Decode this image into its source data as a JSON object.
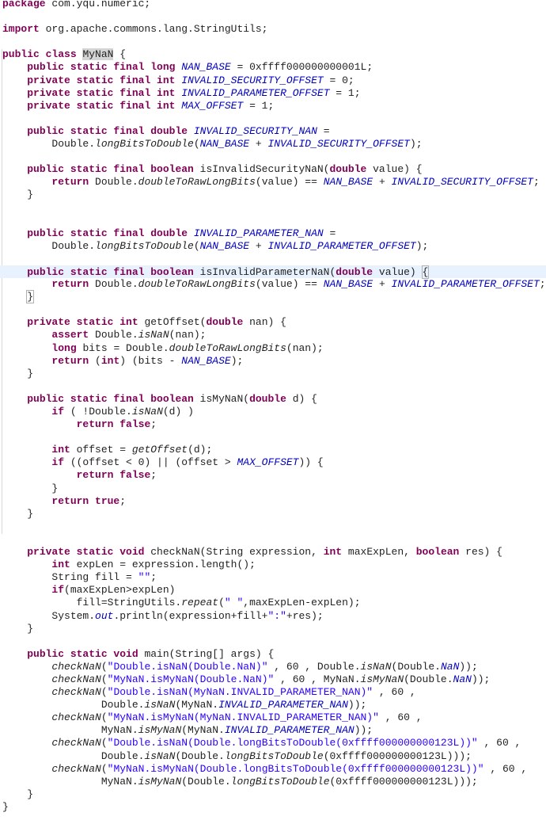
{
  "editor": {
    "current_line": 22,
    "colors": {
      "keyword": "#7f0055",
      "constant": "#0000c0",
      "string": "#2a00ff",
      "current_line_bg": "#e8f2fe"
    },
    "lines": [
      [
        [
          "k",
          "package"
        ],
        [
          "t",
          " com.yqu.numeric;"
        ]
      ],
      [],
      [
        [
          "k",
          "import"
        ],
        [
          "t",
          " org.apache.commons.lang.StringUtils;"
        ]
      ],
      [],
      [
        [
          "k",
          "public class"
        ],
        [
          "t",
          " "
        ],
        [
          "h",
          "MyNaN"
        ],
        [
          "t",
          " {"
        ]
      ],
      [
        [
          "t",
          "    "
        ],
        [
          "k",
          "public static final long"
        ],
        [
          "t",
          " "
        ],
        [
          "c",
          "NAN_BASE"
        ],
        [
          "t",
          " = 0xffff000000000001L;"
        ]
      ],
      [
        [
          "t",
          "    "
        ],
        [
          "k",
          "private static final int"
        ],
        [
          "t",
          " "
        ],
        [
          "c",
          "INVALID_SECURITY_OFFSET"
        ],
        [
          "t",
          " = 0;"
        ]
      ],
      [
        [
          "t",
          "    "
        ],
        [
          "k",
          "private static final int"
        ],
        [
          "t",
          " "
        ],
        [
          "c",
          "INVALID_PARAMETER_OFFSET"
        ],
        [
          "t",
          " = 1;"
        ]
      ],
      [
        [
          "t",
          "    "
        ],
        [
          "k",
          "private static final int"
        ],
        [
          "t",
          " "
        ],
        [
          "c",
          "MAX_OFFSET"
        ],
        [
          "t",
          " = 1;"
        ]
      ],
      [],
      [
        [
          "t",
          "    "
        ],
        [
          "k",
          "public static final double"
        ],
        [
          "t",
          " "
        ],
        [
          "c",
          "INVALID_SECURITY_NAN"
        ],
        [
          "t",
          " ="
        ]
      ],
      [
        [
          "t",
          "        Double."
        ],
        [
          "m",
          "longBitsToDouble"
        ],
        [
          "t",
          "("
        ],
        [
          "c",
          "NAN_BASE"
        ],
        [
          "t",
          " + "
        ],
        [
          "c",
          "INVALID_SECURITY_OFFSET"
        ],
        [
          "t",
          ");"
        ]
      ],
      [],
      [
        [
          "t",
          "    "
        ],
        [
          "k",
          "public static final boolean"
        ],
        [
          "t",
          " isInvalidSecurityNaN("
        ],
        [
          "k",
          "double"
        ],
        [
          "t",
          " value) {"
        ]
      ],
      [
        [
          "t",
          "        "
        ],
        [
          "k",
          "return"
        ],
        [
          "t",
          " Double."
        ],
        [
          "m",
          "doubleToRawLongBits"
        ],
        [
          "t",
          "(value) == "
        ],
        [
          "c",
          "NAN_BASE"
        ],
        [
          "t",
          " + "
        ],
        [
          "c",
          "INVALID_SECURITY_OFFSET"
        ],
        [
          "t",
          ";"
        ]
      ],
      [
        [
          "t",
          "    }"
        ]
      ],
      [],
      [],
      [
        [
          "t",
          "    "
        ],
        [
          "k",
          "public static final double"
        ],
        [
          "t",
          " "
        ],
        [
          "c",
          "INVALID_PARAMETER_NAN"
        ],
        [
          "t",
          " ="
        ]
      ],
      [
        [
          "t",
          "        Double."
        ],
        [
          "m",
          "longBitsToDouble"
        ],
        [
          "t",
          "("
        ],
        [
          "c",
          "NAN_BASE"
        ],
        [
          "t",
          " + "
        ],
        [
          "c",
          "INVALID_PARAMETER_OFFSET"
        ],
        [
          "t",
          ");"
        ]
      ],
      [],
      [
        [
          "t",
          "    "
        ],
        [
          "k",
          "public static final boolean"
        ],
        [
          "t",
          " isInvalidParameterNaN("
        ],
        [
          "k",
          "double"
        ],
        [
          "t",
          " value) "
        ],
        [
          "b",
          "{"
        ],
        [
          "caret",
          ""
        ]
      ],
      [
        [
          "t",
          "        "
        ],
        [
          "k",
          "return"
        ],
        [
          "t",
          " Double."
        ],
        [
          "m",
          "doubleToRawLongBits"
        ],
        [
          "t",
          "(value) == "
        ],
        [
          "c",
          "NAN_BASE"
        ],
        [
          "t",
          " + "
        ],
        [
          "c",
          "INVALID_PARAMETER_OFFSET"
        ],
        [
          "t",
          ";"
        ]
      ],
      [
        [
          "t",
          "    "
        ],
        [
          "b",
          "}"
        ]
      ],
      [],
      [
        [
          "t",
          "    "
        ],
        [
          "k",
          "private static int"
        ],
        [
          "t",
          " getOffset("
        ],
        [
          "k",
          "double"
        ],
        [
          "t",
          " nan) {"
        ]
      ],
      [
        [
          "t",
          "        "
        ],
        [
          "k",
          "assert"
        ],
        [
          "t",
          " Double."
        ],
        [
          "m",
          "isNaN"
        ],
        [
          "t",
          "(nan);"
        ]
      ],
      [
        [
          "t",
          "        "
        ],
        [
          "k",
          "long"
        ],
        [
          "t",
          " bits = Double."
        ],
        [
          "m",
          "doubleToRawLongBits"
        ],
        [
          "t",
          "(nan);"
        ]
      ],
      [
        [
          "t",
          "        "
        ],
        [
          "k",
          "return"
        ],
        [
          "t",
          " ("
        ],
        [
          "k",
          "int"
        ],
        [
          "t",
          ") (bits - "
        ],
        [
          "c",
          "NAN_BASE"
        ],
        [
          "t",
          ");"
        ]
      ],
      [
        [
          "t",
          "    }"
        ]
      ],
      [],
      [
        [
          "t",
          "    "
        ],
        [
          "k",
          "public static final boolean"
        ],
        [
          "t",
          " isMyNaN("
        ],
        [
          "k",
          "double"
        ],
        [
          "t",
          " d) {"
        ]
      ],
      [
        [
          "t",
          "        "
        ],
        [
          "k",
          "if"
        ],
        [
          "t",
          " ( !Double."
        ],
        [
          "m",
          "isNaN"
        ],
        [
          "t",
          "(d) )"
        ]
      ],
      [
        [
          "t",
          "            "
        ],
        [
          "k",
          "return false"
        ],
        [
          "t",
          ";"
        ]
      ],
      [],
      [
        [
          "t",
          "        "
        ],
        [
          "k",
          "int"
        ],
        [
          "t",
          " offset = "
        ],
        [
          "m",
          "getOffset"
        ],
        [
          "t",
          "(d);"
        ]
      ],
      [
        [
          "t",
          "        "
        ],
        [
          "k",
          "if"
        ],
        [
          "t",
          " ((offset < 0) || (offset > "
        ],
        [
          "c",
          "MAX_OFFSET"
        ],
        [
          "t",
          ")) {"
        ]
      ],
      [
        [
          "t",
          "            "
        ],
        [
          "k",
          "return false"
        ],
        [
          "t",
          ";"
        ]
      ],
      [
        [
          "t",
          "        }"
        ]
      ],
      [
        [
          "t",
          "        "
        ],
        [
          "k",
          "return true"
        ],
        [
          "t",
          ";"
        ]
      ],
      [
        [
          "t",
          "    }"
        ]
      ],
      [],
      [],
      [
        [
          "t",
          "    "
        ],
        [
          "k",
          "private static void"
        ],
        [
          "t",
          " checkNaN(String expression, "
        ],
        [
          "k",
          "int"
        ],
        [
          "t",
          " maxExpLen, "
        ],
        [
          "k",
          "boolean"
        ],
        [
          "t",
          " res) {"
        ]
      ],
      [
        [
          "t",
          "        "
        ],
        [
          "k",
          "int"
        ],
        [
          "t",
          " expLen = expression.length();"
        ]
      ],
      [
        [
          "t",
          "        String fill = "
        ],
        [
          "s",
          "\"\""
        ],
        [
          "t",
          ";"
        ]
      ],
      [
        [
          "t",
          "        "
        ],
        [
          "k",
          "if"
        ],
        [
          "t",
          "(maxExpLen>expLen)"
        ]
      ],
      [
        [
          "t",
          "            fill=StringUtils."
        ],
        [
          "m",
          "repeat"
        ],
        [
          "t",
          "("
        ],
        [
          "s",
          "\" \""
        ],
        [
          "t",
          ",maxExpLen-expLen);"
        ]
      ],
      [
        [
          "t",
          "        System."
        ],
        [
          "c",
          "out"
        ],
        [
          "t",
          ".println(expression+fill+"
        ],
        [
          "s",
          "\":\""
        ],
        [
          "t",
          "+res);"
        ]
      ],
      [
        [
          "t",
          "    }"
        ]
      ],
      [],
      [
        [
          "t",
          "    "
        ],
        [
          "k",
          "public static void"
        ],
        [
          "t",
          " main(String[] args) {"
        ]
      ],
      [
        [
          "t",
          "        "
        ],
        [
          "m",
          "checkNaN"
        ],
        [
          "t",
          "("
        ],
        [
          "s",
          "\"Double.isNaN(Double.NaN)\""
        ],
        [
          "t",
          " , 60 , Double."
        ],
        [
          "m",
          "isNaN"
        ],
        [
          "t",
          "(Double."
        ],
        [
          "c",
          "NaN"
        ],
        [
          "t",
          "));"
        ]
      ],
      [
        [
          "t",
          "        "
        ],
        [
          "m",
          "checkNaN"
        ],
        [
          "t",
          "("
        ],
        [
          "s",
          "\"MyNaN.isMyNaN(Double.NaN)\""
        ],
        [
          "t",
          " , 60 , MyNaN."
        ],
        [
          "m",
          "isMyNaN"
        ],
        [
          "t",
          "(Double."
        ],
        [
          "c",
          "NaN"
        ],
        [
          "t",
          "));"
        ]
      ],
      [
        [
          "t",
          "        "
        ],
        [
          "m",
          "checkNaN"
        ],
        [
          "t",
          "("
        ],
        [
          "s",
          "\"Double.isNaN(MyNaN.INVALID_PARAMETER_NAN)\""
        ],
        [
          "t",
          " , 60 ,"
        ]
      ],
      [
        [
          "t",
          "                Double."
        ],
        [
          "m",
          "isNaN"
        ],
        [
          "t",
          "(MyNaN."
        ],
        [
          "c",
          "INVALID_PARAMETER_NAN"
        ],
        [
          "t",
          "));"
        ]
      ],
      [
        [
          "t",
          "        "
        ],
        [
          "m",
          "checkNaN"
        ],
        [
          "t",
          "("
        ],
        [
          "s",
          "\"MyNaN.isMyNaN(MyNaN.INVALID_PARAMETER_NAN)\""
        ],
        [
          "t",
          " , 60 ,"
        ]
      ],
      [
        [
          "t",
          "                MyNaN."
        ],
        [
          "m",
          "isMyNaN"
        ],
        [
          "t",
          "(MyNaN."
        ],
        [
          "c",
          "INVALID_PARAMETER_NAN"
        ],
        [
          "t",
          "));"
        ]
      ],
      [
        [
          "t",
          "        "
        ],
        [
          "m",
          "checkNaN"
        ],
        [
          "t",
          "("
        ],
        [
          "s",
          "\"Double.isNaN(Double.longBitsToDouble(0xffff000000000123L))\""
        ],
        [
          "t",
          " , 60 ,"
        ]
      ],
      [
        [
          "t",
          "                Double."
        ],
        [
          "m",
          "isNaN"
        ],
        [
          "t",
          "(Double."
        ],
        [
          "m",
          "longBitsToDouble"
        ],
        [
          "t",
          "(0xffff000000000123L)));"
        ]
      ],
      [
        [
          "t",
          "        "
        ],
        [
          "m",
          "checkNaN"
        ],
        [
          "t",
          "("
        ],
        [
          "s",
          "\"MyNaN.isMyNaN(Double.longBitsToDouble(0xffff000000000123L))\""
        ],
        [
          "t",
          " , 60 ,"
        ]
      ],
      [
        [
          "t",
          "                MyNaN."
        ],
        [
          "m",
          "isMyNaN"
        ],
        [
          "t",
          "(Double."
        ],
        [
          "m",
          "longBitsToDouble"
        ],
        [
          "t",
          "(0xffff000000000123L)));"
        ]
      ],
      [
        [
          "t",
          "    }"
        ]
      ],
      [
        [
          "t",
          "}"
        ]
      ]
    ]
  }
}
